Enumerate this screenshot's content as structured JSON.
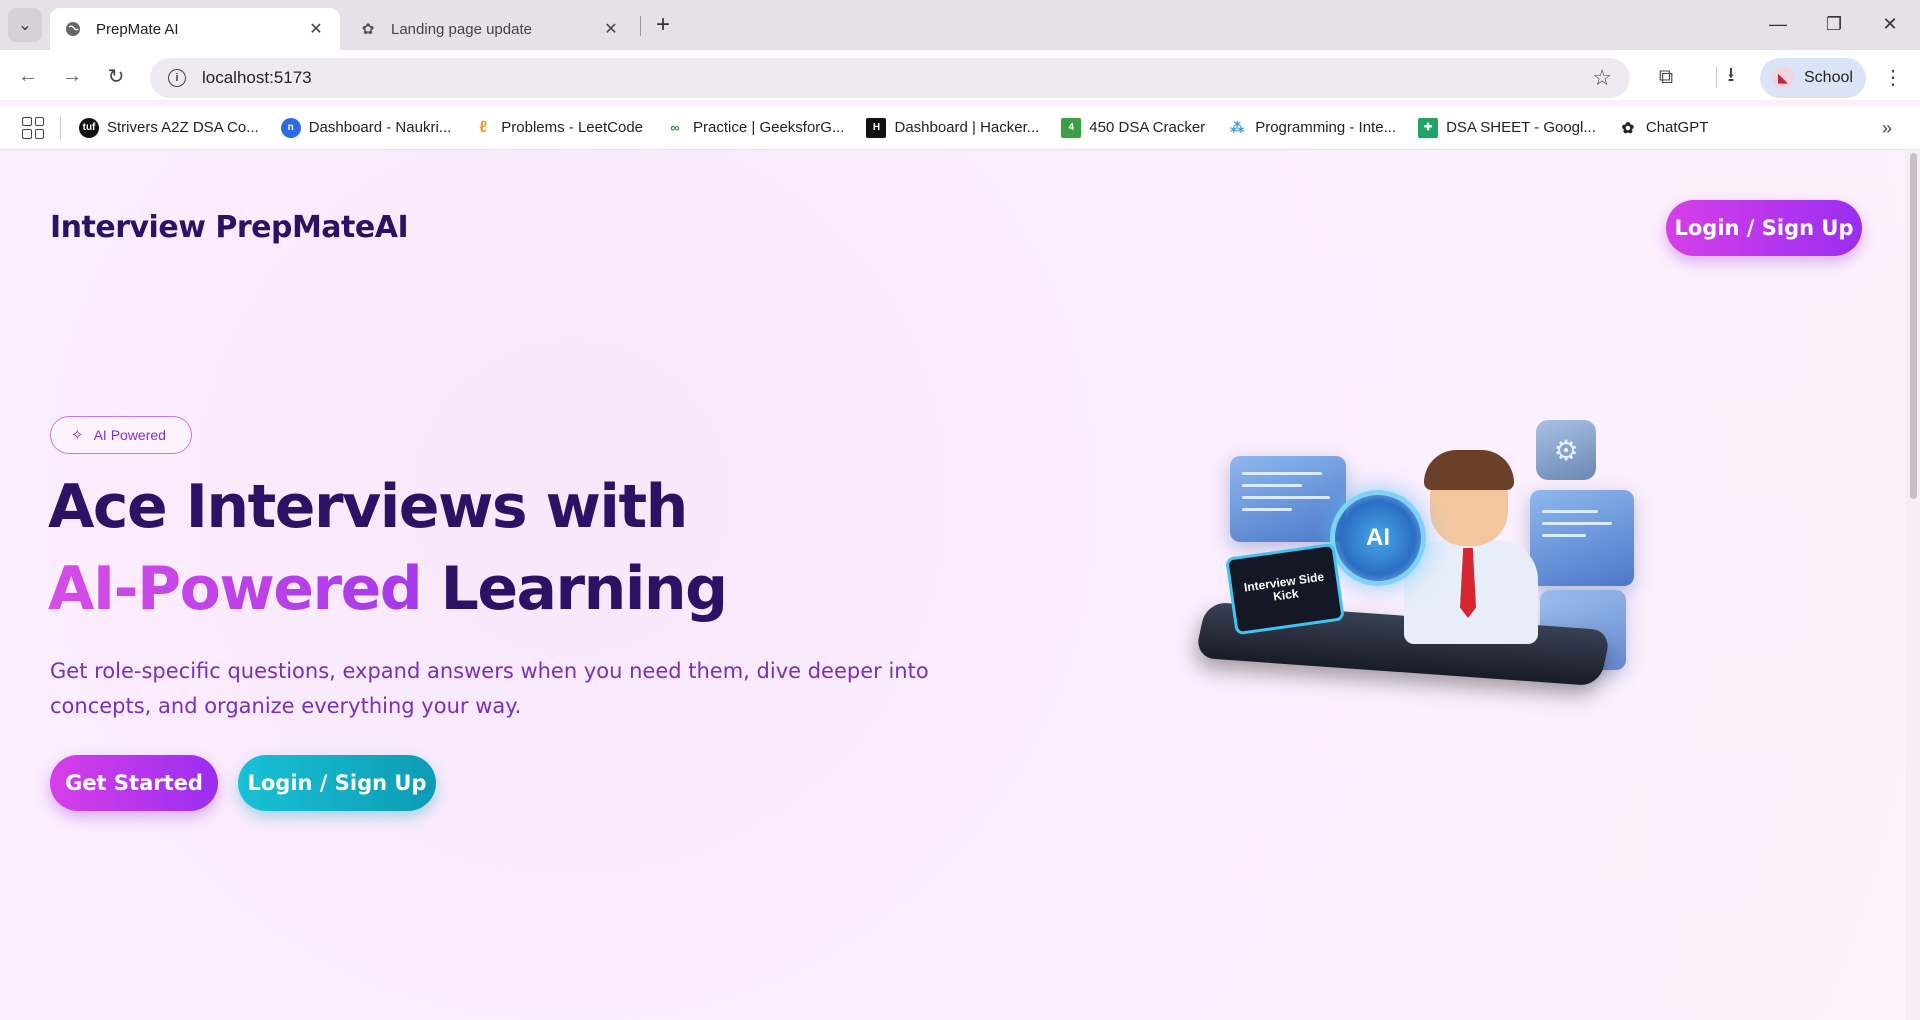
{
  "browser": {
    "tabs": [
      {
        "title": "PrepMate AI",
        "icon": "globe-icon",
        "active": true
      },
      {
        "title": "Landing page update",
        "icon": "chatgpt-icon",
        "active": false
      }
    ],
    "url": "localhost:5173",
    "profile_label": "School",
    "bookmarks": [
      {
        "label": "Strivers A2Z DSA Co...",
        "icon": "tuf-icon",
        "color": "#111111"
      },
      {
        "label": "Dashboard - Naukri...",
        "icon": "naukri-icon",
        "color": "#2d6be4"
      },
      {
        "label": "Problems - LeetCode",
        "icon": "leetcode-icon",
        "color": "#f0a020"
      },
      {
        "label": "Practice | GeeksforG...",
        "icon": "gfg-icon",
        "color": "#2f8d46"
      },
      {
        "label": "Dashboard | Hacker...",
        "icon": "hackerrank-icon",
        "color": "#111111"
      },
      {
        "label": "450 DSA Cracker",
        "icon": "dsa-cracker-icon",
        "color": "#3aa043"
      },
      {
        "label": "Programming - Inte...",
        "icon": "programming-icon",
        "color": "#4a9fd6"
      },
      {
        "label": "DSA SHEET - Googl...",
        "icon": "sheets-icon",
        "color": "#1fa463"
      },
      {
        "label": "ChatGPT",
        "icon": "chatgpt-icon",
        "color": "#222222"
      }
    ]
  },
  "page": {
    "brand": "Interview PrepMateAI",
    "header_login_label": "Login / Sign Up",
    "badge_label": "AI Powered",
    "hero_line1": "Ace Interviews with",
    "hero_accent": "AI-Powered",
    "hero_line2_rest": " Learning",
    "hero_subtitle": "Get role-specific questions, expand answers when you need them, dive deeper into concepts, and organize everything your way.",
    "cta_primary": "Get Started",
    "cta_secondary": "Login / Sign Up",
    "illustration": {
      "laptop_text": "Interview Side Kick",
      "ai_label": "AI"
    }
  },
  "colors": {
    "brand_dark": "#2c1265",
    "accent_purple": "#b23ee8",
    "accent_teal": "#13aec6",
    "page_bg": "#fbeefe"
  }
}
